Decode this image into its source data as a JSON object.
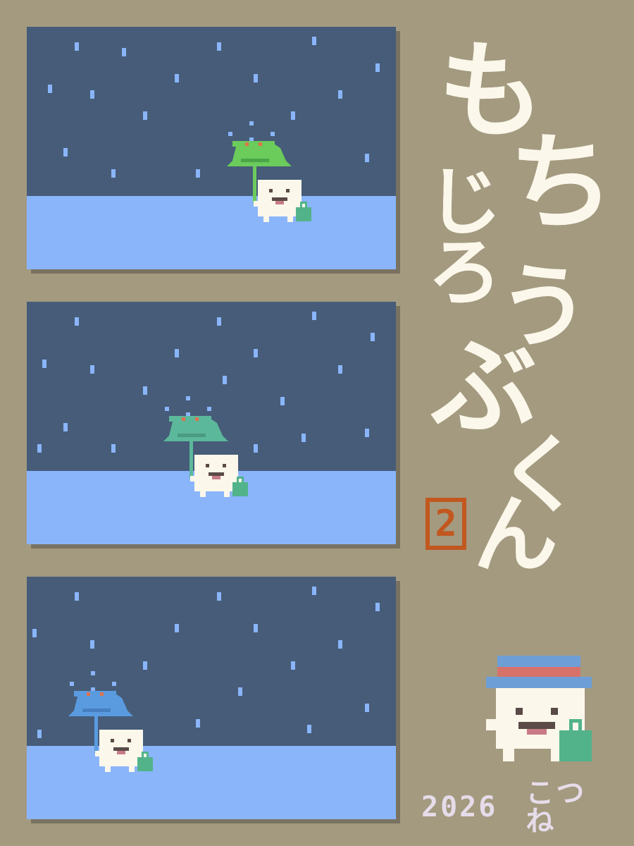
{
  "title": {
    "chars": [
      "も",
      "ち",
      "じ",
      "ろ",
      "う",
      "ぶ",
      "く",
      "ん"
    ]
  },
  "volume": "2",
  "footer": {
    "year": "2026",
    "author": "こつね"
  },
  "colors": {
    "background": "#a39a80",
    "sky": "#465c78",
    "ground": "#8ab5fb",
    "rain": "#8ab5fb",
    "title": "#fbf7ea",
    "volume": "#c2581f",
    "mochi": "#fbf7ea",
    "bag": "#52b38a",
    "hat_band": "#d7726a",
    "hat_brim": "#6d9fd6"
  },
  "panels": [
    {
      "name": "panel-1",
      "umbrella_color": "#6bcb5b",
      "icon": "green-umbrella-icon"
    },
    {
      "name": "panel-2",
      "umbrella_color": "#5cb89b",
      "icon": "teal-umbrella-icon"
    },
    {
      "name": "panel-3",
      "umbrella_color": "#5a9be0",
      "icon": "blue-umbrella-icon"
    }
  ]
}
